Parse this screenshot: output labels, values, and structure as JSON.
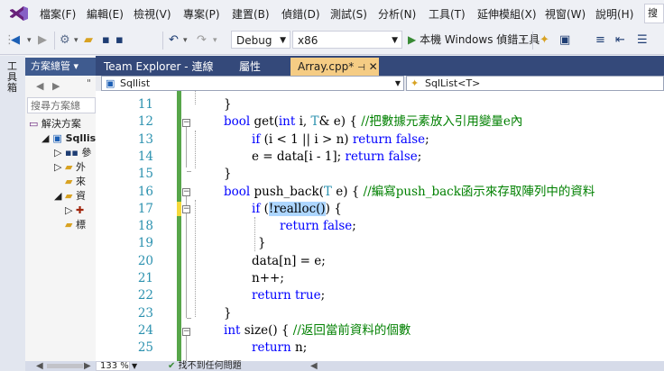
{
  "menu": {
    "items": [
      "檔案(F)",
      "編輯(E)",
      "檢視(V)",
      "專案(P)",
      "建置(B)",
      "偵錯(D)",
      "測試(S)",
      "分析(N)",
      "工具(T)",
      "延伸模組(X)",
      "視窗(W)",
      "說明(H)",
      "搜"
    ]
  },
  "toolbar": {
    "config": "Debug",
    "platform": "x86",
    "run_label": "本機 Windows 偵錯工具"
  },
  "toolbox": {
    "label": "工具箱"
  },
  "solution_explorer": {
    "title": "方案總管",
    "search_placeholder": "搜尋方案總",
    "items": [
      "解決方案",
      "Sqllis",
      "參",
      "外",
      "來",
      "資",
      "標"
    ]
  },
  "tabs": [
    {
      "label": "Team Explorer - 連線"
    },
    {
      "label": "屬性"
    },
    {
      "label": "Array.cpp*"
    }
  ],
  "navbar": {
    "scope": "Sqllist",
    "member": "SqlList<T>"
  },
  "editor": {
    "line_numbers": [
      "11",
      "12",
      "13",
      "14",
      "15",
      "16",
      "17",
      "18",
      "19",
      "20",
      "21",
      "22",
      "23",
      "24",
      "25"
    ],
    "lines": {
      "l11": "}",
      "l12_a": "bool",
      "l12_b": " get(",
      "l12_c": "int",
      "l12_d": " i, ",
      "l12_e": "T",
      "l12_f": "& e) { ",
      "l12_g": "//把數據元素放入引用變量e內",
      "l13_a": "if",
      "l13_b": " (i < 1 || i > n) ",
      "l13_c": "return false",
      "l13_d": ";",
      "l14_a": "e = data[i - 1]; ",
      "l14_b": "return false",
      "l14_c": ";",
      "l15": "}",
      "l16_a": "bool",
      "l16_b": " push_back(",
      "l16_c": "T",
      "l16_d": " e) { ",
      "l16_e": "//編寫push_back函示來存取陣列中的資料",
      "l17_a": "if",
      "l17_b": " (",
      "l17_c": "!realloc()",
      "l17_d": ")",
      "l17_e": " {",
      "l18_a": "return false",
      "l18_b": ";",
      "l19": "}",
      "l20": "data[n] = e;",
      "l21": "n++;",
      "l22_a": "return true",
      "l22_b": ";",
      "l23": "}",
      "l24_a": "int",
      "l24_b": " size() { ",
      "l24_c": "//返回當前資料的個數",
      "l25_a": "return",
      "l25_b": " n;"
    }
  },
  "status": {
    "zoom": "133 %",
    "issues": "找不到任何問題"
  },
  "colors": {
    "tab_bar": "#34497a",
    "active_tab": "#f5cc84",
    "keyword": "#0000ff",
    "comment": "#008000",
    "line_number": "#2b91af",
    "change_bar": "#57a64a"
  }
}
